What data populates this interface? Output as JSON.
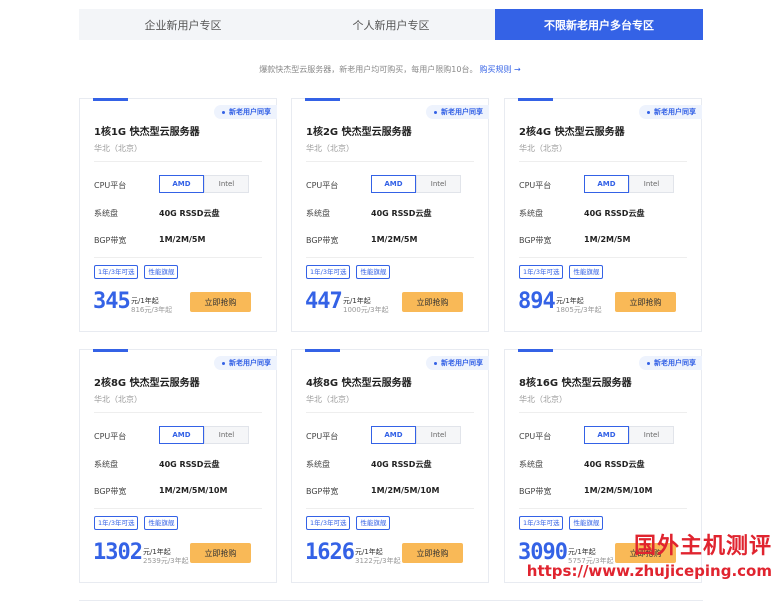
{
  "tabs": [
    {
      "label": "企业新用户专区",
      "active": false
    },
    {
      "label": "个人新用户专区",
      "active": false
    },
    {
      "label": "不限新老用户多台专区",
      "active": true
    }
  ],
  "subtitle": {
    "text": "爆款快杰型云服务器，新老用户均可购买，每用户限购10台。",
    "link": "购买规则 →"
  },
  "labels": {
    "badge": "新老用户同享",
    "cpu": "CPU平台",
    "cpu_amd": "AMD",
    "cpu_intel": "Intel",
    "disk": "系统盘",
    "bandwidth": "BGP带宽",
    "tag1": "1年/3年可选",
    "tag2": "性能旗舰",
    "price_unit": "元/1年起",
    "buy": "立即抢购"
  },
  "products": [
    {
      "name": "1核1G 快杰型云服务器",
      "region": "华北（北京）",
      "disk": "40G RSSD云盘",
      "bandwidth": "1M/2M/5M",
      "price": "345",
      "price_sub": "816元/3年起"
    },
    {
      "name": "1核2G 快杰型云服务器",
      "region": "华北（北京）",
      "disk": "40G RSSD云盘",
      "bandwidth": "1M/2M/5M",
      "price": "447",
      "price_sub": "1000元/3年起"
    },
    {
      "name": "2核4G 快杰型云服务器",
      "region": "华北（北京）",
      "disk": "40G RSSD云盘",
      "bandwidth": "1M/2M/5M",
      "price": "894",
      "price_sub": "1805元/3年起"
    },
    {
      "name": "2核8G 快杰型云服务器",
      "region": "华北（北京）",
      "disk": "40G RSSD云盘",
      "bandwidth": "1M/2M/5M/10M",
      "price": "1302",
      "price_sub": "2539元/3年起"
    },
    {
      "name": "4核8G 快杰型云服务器",
      "region": "华北（北京）",
      "disk": "40G RSSD云盘",
      "bandwidth": "1M/2M/5M/10M",
      "price": "1626",
      "price_sub": "3122元/3年起"
    },
    {
      "name": "8核16G 快杰型云服务器",
      "region": "华北（北京）",
      "disk": "40G RSSD云盘",
      "bandwidth": "1M/2M/5M/10M",
      "price": "3090",
      "price_sub": "5757元/3年起"
    }
  ],
  "watermark": {
    "title": "国外主机测评",
    "url": "https://www.zhujiceping.com"
  },
  "colors": {
    "accent": "#3462e6",
    "buy": "#f9b957",
    "watermark": "#e0242f"
  }
}
